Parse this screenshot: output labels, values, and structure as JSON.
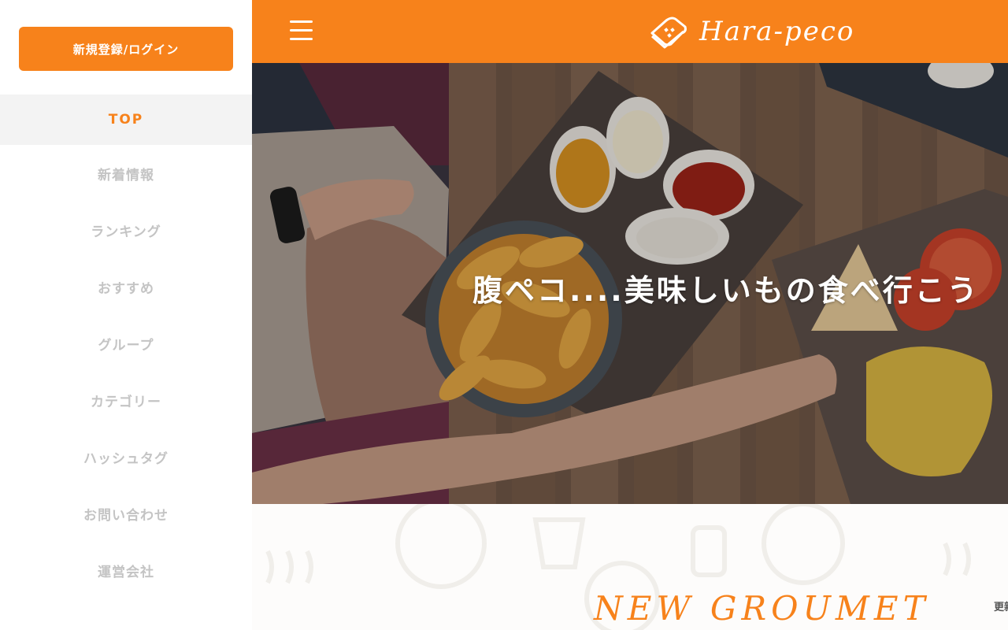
{
  "sidebar": {
    "login_label": "新規登録/ログイン",
    "items": [
      {
        "label": "TOP",
        "active": true
      },
      {
        "label": "新着情報"
      },
      {
        "label": "ランキング"
      },
      {
        "label": "おすすめ"
      },
      {
        "label": "グループ"
      },
      {
        "label": "カテゴリー"
      },
      {
        "label": "ハッシュタグ"
      },
      {
        "label": "お問い合わせ"
      },
      {
        "label": "運営会社"
      }
    ]
  },
  "header": {
    "logo_text": "Hara-peco",
    "menu_icon": "hamburger-icon",
    "logo_icon": "toast-icon"
  },
  "hero": {
    "caption": "腹ペコ....美味しいもの食べ行こう"
  },
  "section": {
    "title": "NEW GROUMET",
    "update_text": "更新"
  },
  "colors": {
    "accent": "#f7821b",
    "nav_inactive": "#c4c4c4",
    "nav_active_bg": "#f3f3f3"
  }
}
